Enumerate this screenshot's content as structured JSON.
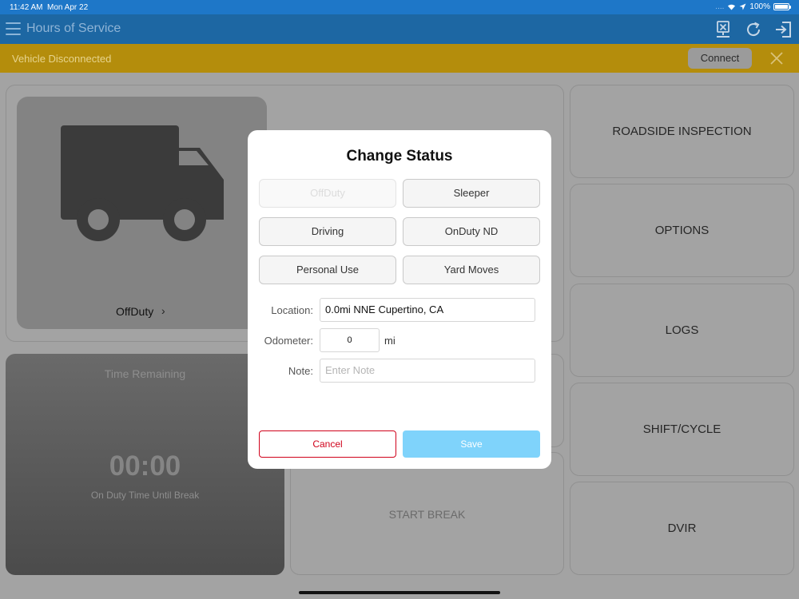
{
  "status_bar": {
    "time": "11:42 AM",
    "date": "Mon Apr 22",
    "dots": "....",
    "battery": "100%"
  },
  "nav": {
    "title": "Hours of Service",
    "icons": [
      "menu-icon",
      "disconnected-device-icon",
      "refresh-icon",
      "logout-icon"
    ]
  },
  "alert": {
    "message": "Vehicle Disconnected",
    "button": "Connect",
    "close_icon": "close-icon"
  },
  "current_status": {
    "label": "OffDuty",
    "chevron": "›",
    "icon": "truck-icon"
  },
  "time_remaining": {
    "title": "Time Remaining",
    "value": "00:00",
    "subtitle": "On Duty Time Until Break"
  },
  "start_break": {
    "label": "START BREAK"
  },
  "menu": {
    "items": [
      {
        "label": "ROADSIDE INSPECTION"
      },
      {
        "label": "OPTIONS"
      },
      {
        "label": "LOGS"
      },
      {
        "label": "SHIFT/CYCLE"
      },
      {
        "label": "DVIR"
      }
    ]
  },
  "modal": {
    "title": "Change Status",
    "statuses": [
      {
        "label": "OffDuty",
        "disabled": true
      },
      {
        "label": "Sleeper"
      },
      {
        "label": "Driving"
      },
      {
        "label": "OnDuty ND"
      },
      {
        "label": "Personal Use"
      },
      {
        "label": "Yard Moves"
      }
    ],
    "location": {
      "label": "Location:",
      "value": "0.0mi NNE Cupertino, CA"
    },
    "odometer": {
      "label": "Odometer:",
      "value": "0",
      "unit": "mi"
    },
    "note": {
      "label": "Note:",
      "placeholder": "Enter Note"
    },
    "cancel": "Cancel",
    "save": "Save"
  },
  "colors": {
    "status_bar": "#1e77c8",
    "nav_bar": "#1d67a3",
    "alert": "#b48d0c",
    "cancel": "#d0021b",
    "save": "#7fd3fb"
  }
}
